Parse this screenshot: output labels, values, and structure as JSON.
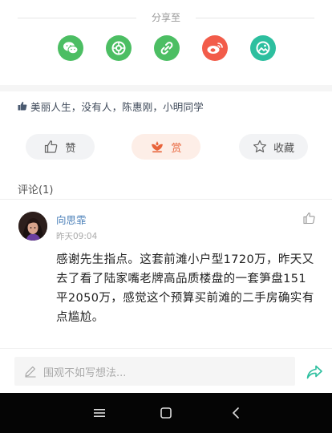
{
  "share": {
    "title": "分享至",
    "targets": [
      {
        "icon": "wechat-icon",
        "color": "#4cbe63"
      },
      {
        "icon": "moments-icon",
        "color": "#4cbe63"
      },
      {
        "icon": "link-icon",
        "color": "#4cbe63"
      },
      {
        "icon": "weibo-icon",
        "color": "#f25c4a"
      },
      {
        "icon": "image-share-icon",
        "color": "#2dbf9f"
      }
    ]
  },
  "likes": {
    "names": "美丽人生，没有人，陈惠刚，小明同学"
  },
  "actions": {
    "like_label": "赞",
    "reward_label": "赏",
    "favorite_label": "收藏"
  },
  "comments": {
    "header": "评论(1)",
    "items": [
      {
        "name": "向思霏",
        "time": "昨天09:04",
        "text": "感谢先生指点。这套前滩小户型1720万，昨天又去了看了陆家嘴老牌高品质楼盘的一套笋盘151平2050万，感觉这个预算买前滩的二手房确实有点尴尬。"
      }
    ]
  },
  "composer": {
    "placeholder": "围观不如写想法..."
  },
  "colors": {
    "accent_green": "#4cbe63",
    "weibo_red": "#f25c4a",
    "reward_orange": "#e8633a",
    "name_blue": "#4a7fb8"
  }
}
